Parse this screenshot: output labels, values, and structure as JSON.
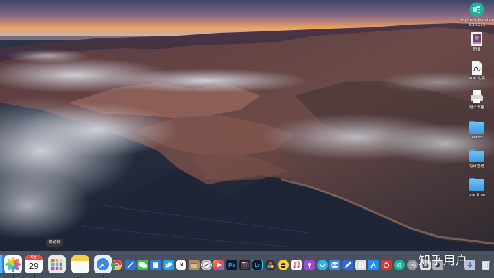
{
  "desktop": {
    "items": [
      {
        "label": "Logitech Installer\n8.20.233",
        "icon": "logitech-installer-icon"
      },
      {
        "label": "图像",
        "icon": "image-file-icon"
      },
      {
        "label": "PDF 文稿",
        "icon": "pdf-document-icon"
      },
      {
        "label": "电子表格",
        "icon": "spreadsheet-printer-icon"
      },
      {
        "label": "Lemo",
        "icon": "folder-icon"
      },
      {
        "label": "每日整理",
        "icon": "folder-icon"
      },
      {
        "label": "one time",
        "icon": "folder-icon"
      }
    ]
  },
  "dock": {
    "tooltip": "启动台",
    "calendar": {
      "month": "6月",
      "day": "29"
    },
    "apps": [
      "finder-icon",
      "photos-icon",
      "calendar-icon",
      "launchpad-icon",
      "notes-icon",
      "safari-icon",
      "chrome-icon",
      "feather-icon",
      "wechat-icon",
      "paste-icon",
      "twitter-icon",
      "notion-icon",
      "tot-icon",
      "keka-icon",
      "infuse-icon",
      "photoshop-icon",
      "final-cut-icon",
      "lightroom-icon",
      "davinci-icon",
      "bee-icon",
      "music-icon",
      "podcasts-icon",
      "qq-browser-icon",
      "teamviewer-icon",
      "pencil-icon",
      "app-store-icon",
      "netease-music-icon",
      "notebook-icon",
      "logitech-icon",
      "settings-icon",
      "screenshot-icon",
      "recorder-icon",
      "downloads-icon",
      "trash-icon"
    ],
    "labels": {
      "photoshop": "Ps",
      "lightroom": "Lr",
      "notion": "N"
    }
  },
  "watermark": "知乎用户",
  "colors": {
    "sky_top": "#3b4a6b",
    "sky_glow": "#f2a35c",
    "ocean": "#202a3c",
    "fog": "#c9cbd4",
    "dock_bg": "#a0a5af"
  }
}
